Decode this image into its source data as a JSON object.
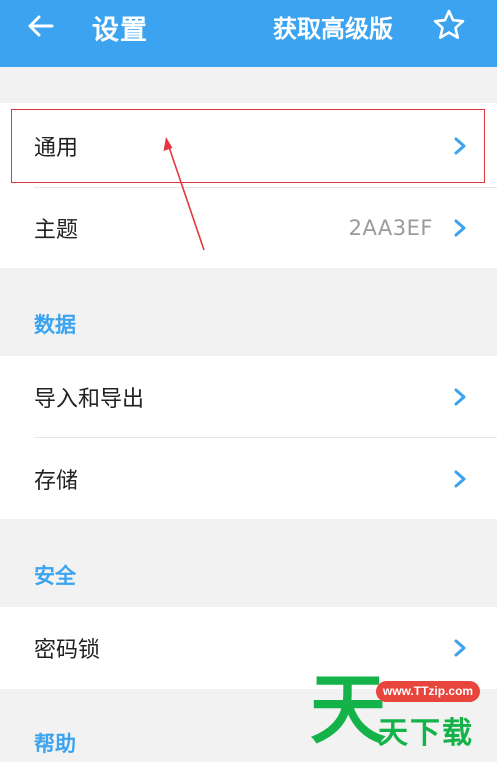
{
  "header": {
    "back_icon": "arrow-left-icon",
    "title": "设置",
    "pro_label": "获取高级版",
    "star_icon": "star-outline-icon"
  },
  "general_section": {
    "rows": [
      {
        "label": "通用",
        "value": ""
      },
      {
        "label": "主题",
        "value": "2AA3EF"
      }
    ]
  },
  "data_section": {
    "header": "数据",
    "rows": [
      {
        "label": "导入和导出"
      },
      {
        "label": "存储"
      }
    ]
  },
  "security_section": {
    "header": "安全",
    "rows": [
      {
        "label": "密码锁"
      }
    ]
  },
  "help_section": {
    "header": "帮助"
  },
  "watermark": {
    "big_char": "天",
    "url": "www.TTzip.com",
    "text": "天下载"
  },
  "colors": {
    "accent": "#3ba3ef",
    "annotation": "#e0383e",
    "watermark_green": "#14b34a",
    "watermark_red": "#e8453c"
  }
}
